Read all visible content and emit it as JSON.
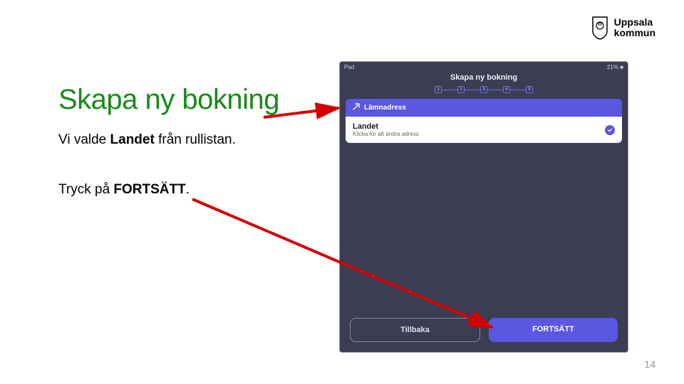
{
  "logo": {
    "line1": "Uppsala",
    "line2": "kommun"
  },
  "title": "Skapa ny bokning",
  "line1_pre": "Vi valde ",
  "line1_bold": "Landet",
  "line1_post": " från rullistan.",
  "line2_pre": "Tryck på ",
  "line2_bold": "FORTSÄTT",
  "line2_post": ".",
  "page_number": "14",
  "phone": {
    "status_left": "Pad",
    "status_right": "21% ■",
    "header": "Skapa ny bokning",
    "steps": [
      "1",
      "2",
      "3",
      "4",
      "5"
    ],
    "section_label": "Lämnadress",
    "address_title": "Landet",
    "address_sub": "Klicka för att ändra adress",
    "btn_back": "Tillbaka",
    "btn_forward": "FORTSÄTT"
  }
}
